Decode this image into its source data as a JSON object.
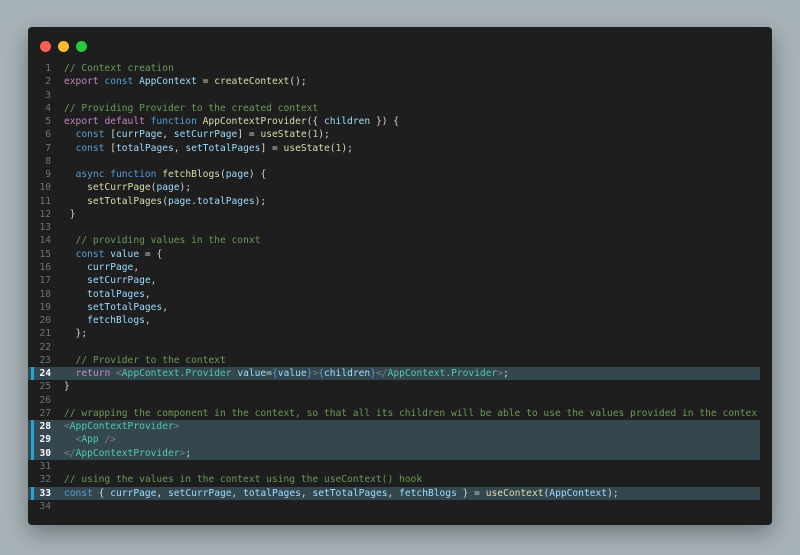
{
  "window": {
    "controls": [
      "close",
      "minimize",
      "maximize"
    ],
    "colors": {
      "close": "#ff5f57",
      "minimize": "#febc2e",
      "maximize": "#28c840",
      "highlight_bar": "#24a3d6"
    }
  },
  "editor": {
    "highlighted_lines": [
      24,
      28,
      29,
      30,
      33
    ],
    "lines": [
      {
        "n": "1",
        "tokens": [
          [
            "c",
            "// Context creation"
          ]
        ]
      },
      {
        "n": "2",
        "tokens": [
          [
            "k",
            "export"
          ],
          [
            "p",
            " "
          ],
          [
            "b",
            "const"
          ],
          [
            "p",
            " "
          ],
          [
            "v",
            "AppContext"
          ],
          [
            "p",
            " = "
          ],
          [
            "f",
            "createContext"
          ],
          [
            "p",
            "();"
          ]
        ]
      },
      {
        "n": "3",
        "tokens": []
      },
      {
        "n": "4",
        "tokens": [
          [
            "c",
            "// Providing Provider to the created context"
          ]
        ]
      },
      {
        "n": "5",
        "tokens": [
          [
            "k",
            "export"
          ],
          [
            "p",
            " "
          ],
          [
            "k",
            "default"
          ],
          [
            "p",
            " "
          ],
          [
            "b",
            "function"
          ],
          [
            "p",
            " "
          ],
          [
            "f",
            "AppContextProvider"
          ],
          [
            "p",
            "({ "
          ],
          [
            "v",
            "children"
          ],
          [
            "p",
            " }) {"
          ]
        ]
      },
      {
        "n": "6",
        "tokens": [
          [
            "p",
            "  "
          ],
          [
            "b",
            "const"
          ],
          [
            "p",
            " ["
          ],
          [
            "v",
            "currPage"
          ],
          [
            "p",
            ", "
          ],
          [
            "v",
            "setCurrPage"
          ],
          [
            "p",
            "] = "
          ],
          [
            "f",
            "useState"
          ],
          [
            "p",
            "("
          ],
          [
            "n",
            "1"
          ],
          [
            "p",
            ");"
          ]
        ]
      },
      {
        "n": "7",
        "tokens": [
          [
            "p",
            "  "
          ],
          [
            "b",
            "const"
          ],
          [
            "p",
            " ["
          ],
          [
            "v",
            "totalPages"
          ],
          [
            "p",
            ", "
          ],
          [
            "v",
            "setTotalPages"
          ],
          [
            "p",
            "] = "
          ],
          [
            "f",
            "useState"
          ],
          [
            "p",
            "("
          ],
          [
            "n",
            "1"
          ],
          [
            "p",
            ");"
          ]
        ]
      },
      {
        "n": "8",
        "tokens": []
      },
      {
        "n": "9",
        "tokens": [
          [
            "p",
            "  "
          ],
          [
            "b",
            "async"
          ],
          [
            "p",
            " "
          ],
          [
            "b",
            "function"
          ],
          [
            "p",
            " "
          ],
          [
            "f",
            "fetchBlogs"
          ],
          [
            "p",
            "("
          ],
          [
            "v",
            "page"
          ],
          [
            "p",
            ") {"
          ]
        ]
      },
      {
        "n": "10",
        "tokens": [
          [
            "p",
            "    "
          ],
          [
            "f",
            "setCurrPage"
          ],
          [
            "p",
            "("
          ],
          [
            "v",
            "page"
          ],
          [
            "p",
            ");"
          ]
        ]
      },
      {
        "n": "11",
        "tokens": [
          [
            "p",
            "    "
          ],
          [
            "f",
            "setTotalPages"
          ],
          [
            "p",
            "("
          ],
          [
            "v",
            "page"
          ],
          [
            "p",
            "."
          ],
          [
            "v",
            "totalPages"
          ],
          [
            "p",
            ");"
          ]
        ]
      },
      {
        "n": "12",
        "tokens": [
          [
            "p",
            " }"
          ]
        ]
      },
      {
        "n": "13",
        "tokens": []
      },
      {
        "n": "14",
        "tokens": [
          [
            "p",
            "  "
          ],
          [
            "c",
            "// providing values in the conxt"
          ]
        ]
      },
      {
        "n": "15",
        "tokens": [
          [
            "p",
            "  "
          ],
          [
            "b",
            "const"
          ],
          [
            "p",
            " "
          ],
          [
            "v",
            "value"
          ],
          [
            "p",
            " = {"
          ]
        ]
      },
      {
        "n": "16",
        "tokens": [
          [
            "p",
            "    "
          ],
          [
            "v",
            "currPage"
          ],
          [
            "p",
            ","
          ]
        ]
      },
      {
        "n": "17",
        "tokens": [
          [
            "p",
            "    "
          ],
          [
            "v",
            "setCurrPage"
          ],
          [
            "p",
            ","
          ]
        ]
      },
      {
        "n": "18",
        "tokens": [
          [
            "p",
            "    "
          ],
          [
            "v",
            "totalPages"
          ],
          [
            "p",
            ","
          ]
        ]
      },
      {
        "n": "19",
        "tokens": [
          [
            "p",
            "    "
          ],
          [
            "v",
            "setTotalPages"
          ],
          [
            "p",
            ","
          ]
        ]
      },
      {
        "n": "20",
        "tokens": [
          [
            "p",
            "    "
          ],
          [
            "v",
            "fetchBlogs"
          ],
          [
            "p",
            ","
          ]
        ]
      },
      {
        "n": "21",
        "tokens": [
          [
            "p",
            "  };"
          ]
        ]
      },
      {
        "n": "22",
        "tokens": []
      },
      {
        "n": "23",
        "tokens": [
          [
            "p",
            "  "
          ],
          [
            "c",
            "// Provider to the context"
          ]
        ]
      },
      {
        "n": "24",
        "tokens": [
          [
            "p",
            "  "
          ],
          [
            "k",
            "return"
          ],
          [
            "p",
            " "
          ],
          [
            "g",
            "<"
          ],
          [
            "t",
            "AppContext.Provider"
          ],
          [
            "p",
            " "
          ],
          [
            "v",
            "value"
          ],
          [
            "p",
            "="
          ],
          [
            "b",
            "{"
          ],
          [
            "v",
            "value"
          ],
          [
            "b",
            "}"
          ],
          [
            "g",
            ">"
          ],
          [
            "b",
            "{"
          ],
          [
            "v",
            "children"
          ],
          [
            "b",
            "}"
          ],
          [
            "g",
            "</"
          ],
          [
            "t",
            "AppContext.Provider"
          ],
          [
            "g",
            ">"
          ],
          [
            "p",
            ";"
          ]
        ]
      },
      {
        "n": "25",
        "tokens": [
          [
            "p",
            "}"
          ]
        ]
      },
      {
        "n": "26",
        "tokens": []
      },
      {
        "n": "27",
        "tokens": [
          [
            "c",
            "// wrapping the component in the context, so that all its children will be able to use the values provided in the contex"
          ]
        ]
      },
      {
        "n": "28",
        "tokens": [
          [
            "g",
            "<"
          ],
          [
            "t",
            "AppContextProvider"
          ],
          [
            "g",
            ">"
          ]
        ]
      },
      {
        "n": "29",
        "tokens": [
          [
            "p",
            "  "
          ],
          [
            "g",
            "<"
          ],
          [
            "t",
            "App"
          ],
          [
            "p",
            " "
          ],
          [
            "g",
            "/>"
          ]
        ]
      },
      {
        "n": "30",
        "tokens": [
          [
            "g",
            "</"
          ],
          [
            "t",
            "AppContextProvider"
          ],
          [
            "g",
            ">"
          ],
          [
            "p",
            ";"
          ]
        ]
      },
      {
        "n": "31",
        "tokens": []
      },
      {
        "n": "32",
        "tokens": [
          [
            "c",
            "// using the values in the context using the useContext() hook"
          ]
        ]
      },
      {
        "n": "33",
        "tokens": [
          [
            "b",
            "const"
          ],
          [
            "p",
            " { "
          ],
          [
            "v",
            "currPage"
          ],
          [
            "p",
            ", "
          ],
          [
            "v",
            "setCurrPage"
          ],
          [
            "p",
            ", "
          ],
          [
            "v",
            "totalPages"
          ],
          [
            "p",
            ", "
          ],
          [
            "v",
            "setTotalPages"
          ],
          [
            "p",
            ", "
          ],
          [
            "v",
            "fetchBlogs"
          ],
          [
            "p",
            " } = "
          ],
          [
            "f",
            "useContext"
          ],
          [
            "p",
            "("
          ],
          [
            "v",
            "AppContext"
          ],
          [
            "p",
            ");"
          ]
        ]
      },
      {
        "n": "34",
        "tokens": []
      }
    ]
  }
}
